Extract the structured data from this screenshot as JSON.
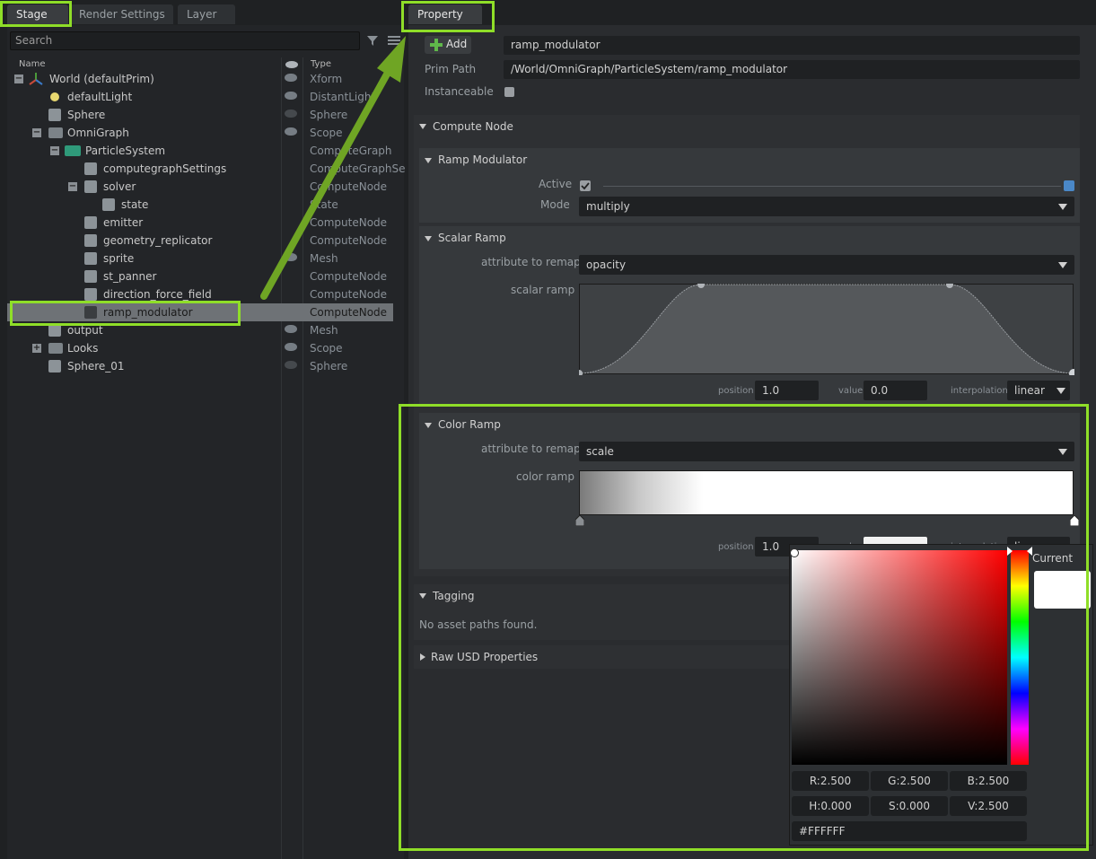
{
  "left_tabs": [
    "Stage",
    "Render Settings",
    "Layer"
  ],
  "right_tab": "Property",
  "stage": {
    "search_placeholder": "Search",
    "col_name": "Name",
    "col_type": "Type",
    "rows": [
      {
        "name": "World (defaultPrim)",
        "type": "Xform"
      },
      {
        "name": "defaultLight",
        "type": "DistantLight"
      },
      {
        "name": "Sphere",
        "type": "Sphere"
      },
      {
        "name": "OmniGraph",
        "type": "Scope"
      },
      {
        "name": "ParticleSystem",
        "type": "ComputeGraph"
      },
      {
        "name": "computegraphSettings",
        "type": "ComputeGraphSe"
      },
      {
        "name": "solver",
        "type": "ComputeNode"
      },
      {
        "name": "state",
        "type": "State"
      },
      {
        "name": "emitter",
        "type": "ComputeNode"
      },
      {
        "name": "geometry_replicator",
        "type": "ComputeNode"
      },
      {
        "name": "sprite",
        "type": "Mesh"
      },
      {
        "name": "st_panner",
        "type": "ComputeNode"
      },
      {
        "name": "direction_force_field",
        "type": "ComputeNode"
      },
      {
        "name": "ramp_modulator",
        "type": "ComputeNode"
      },
      {
        "name": "output",
        "type": "Mesh"
      },
      {
        "name": "Looks",
        "type": "Scope"
      },
      {
        "name": "Sphere_01",
        "type": "Sphere"
      }
    ]
  },
  "property": {
    "add_label": "Add",
    "prim_name": "ramp_modulator",
    "prim_path_label": "Prim Path",
    "prim_path": "/World/OmniGraph/ParticleSystem/ramp_modulator",
    "instanceable_label": "Instanceable",
    "compute_node": "Compute Node",
    "ramp_modulator": {
      "title": "Ramp Modulator",
      "active_label": "Active",
      "mode_label": "Mode",
      "mode_value": "multiply"
    },
    "scalar_ramp": {
      "title": "Scalar Ramp",
      "attr_label": "attribute to remap",
      "attr_value": "opacity",
      "ramp_label": "scalar ramp",
      "position_label": "position",
      "position_value": "1.0",
      "value_label": "value",
      "value_value": "0.0",
      "interp_label": "interpolation",
      "interp_value": "linear"
    },
    "color_ramp": {
      "title": "Color Ramp",
      "attr_label": "attribute to remap",
      "attr_value": "scale",
      "ramp_label": "color ramp",
      "position_label": "position",
      "position_value": "1.0",
      "value_label": "value",
      "interp_label": "interpolation",
      "interp_value": "linear"
    },
    "tagging": {
      "title": "Tagging",
      "empty_text": "No asset paths found."
    },
    "raw_usd": "Raw USD Properties",
    "color_picker": {
      "current_label": "Current",
      "r": "R:2.500",
      "g": "G:2.500",
      "b": "B:2.500",
      "h": "H:0.000",
      "s": "S:0.000",
      "v": "V:2.500",
      "hex": "#FFFFFF"
    }
  },
  "colors": {
    "highlight": "#8fde28",
    "arrow": "#6fa524",
    "panel": "#2a2c2f",
    "selected_row": "#6e7276"
  }
}
